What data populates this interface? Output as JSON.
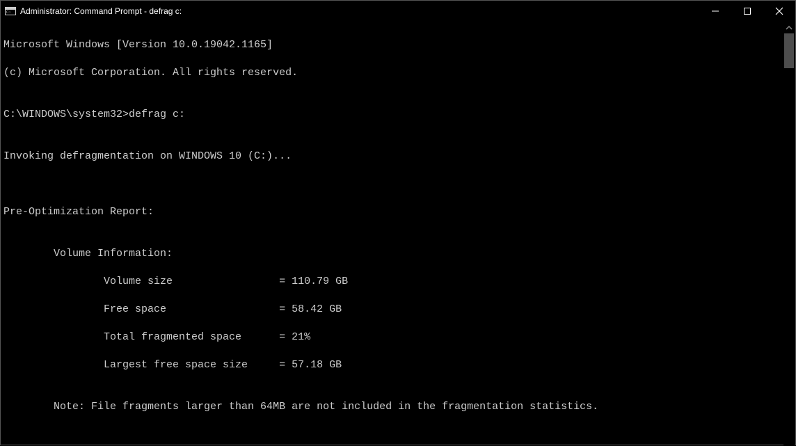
{
  "titlebar": {
    "title": "Administrator: Command Prompt - defrag  c:"
  },
  "terminal": {
    "line1": "Microsoft Windows [Version 10.0.19042.1165]",
    "line2": "(c) Microsoft Corporation. All rights reserved.",
    "blank1": "",
    "prompt_line": "C:\\WINDOWS\\system32>defrag c:",
    "blank2": "",
    "invoking": "Invoking defragmentation on WINDOWS 10 (C:)...",
    "blank3": "",
    "blank4": "",
    "report_header": "Pre-Optimization Report:",
    "blank5": "",
    "vol_info": "        Volume Information:",
    "vol_size": "                Volume size                 = 110.79 GB",
    "free_space": "                Free space                  = 58.42 GB",
    "frag_space": "                Total fragmented space      = 21%",
    "largest_free": "                Largest free space size     = 57.18 GB",
    "blank6": "",
    "note": "        Note: File fragments larger than 64MB are not included in the fragmentation statistics."
  }
}
